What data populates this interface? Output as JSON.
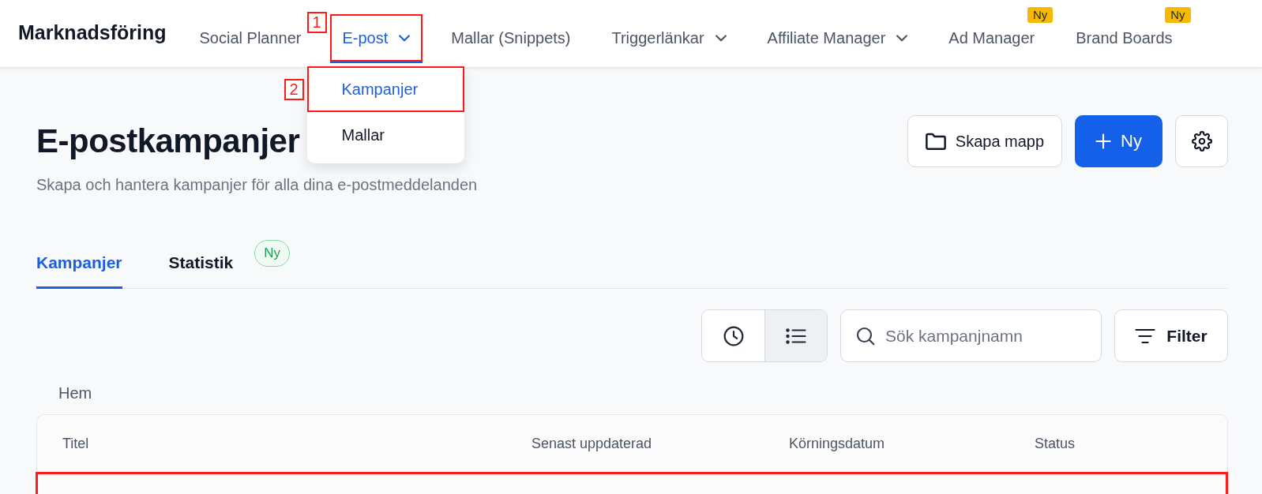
{
  "app": {
    "title": "Marknadsföring"
  },
  "nav": {
    "items": [
      {
        "label": "Social Planner",
        "selected": false,
        "has_menu": false,
        "highlighted": false
      },
      {
        "label": "E-post",
        "selected": true,
        "has_menu": true,
        "highlighted": true,
        "callout": "1",
        "menu": [
          {
            "label": "Kampanjer",
            "selected": true,
            "highlighted": true,
            "callout": "2"
          },
          {
            "label": "Mallar",
            "selected": false,
            "highlighted": false
          }
        ]
      },
      {
        "label": "Mallar (Snippets)",
        "selected": false,
        "has_menu": false,
        "highlighted": false
      },
      {
        "label": "Triggerlänkar",
        "selected": false,
        "has_menu": true,
        "highlighted": false
      },
      {
        "label": "Affiliate Manager",
        "selected": false,
        "has_menu": true,
        "highlighted": false
      },
      {
        "label": "Ad Manager",
        "selected": false,
        "has_menu": false,
        "highlighted": false,
        "badge": "Ny"
      },
      {
        "label": "Brand Boards",
        "selected": false,
        "has_menu": false,
        "highlighted": false,
        "badge": "Ny"
      }
    ]
  },
  "header": {
    "title": "E-postkampanjer",
    "subtitle": "Skapa och hantera kampanjer för alla dina e-postmeddelanden",
    "actions": [
      {
        "kind": "folder",
        "label": "Skapa mapp"
      },
      {
        "kind": "new",
        "label": "Ny"
      },
      {
        "kind": "settings"
      }
    ]
  },
  "tabs": [
    {
      "label": "Kampanjer",
      "selected": true
    },
    {
      "label": "Statistik",
      "selected": false,
      "badge": "Ny"
    }
  ],
  "toolbar": {
    "view_modes": [
      {
        "kind": "clock",
        "selected": false
      },
      {
        "kind": "list",
        "selected": true
      }
    ],
    "search": {
      "placeholder": "Sök kampanjnamn"
    },
    "filter": {
      "label": "Filter"
    }
  },
  "breadcrumb": [
    "Hem"
  ],
  "table": {
    "columns": [
      "Titel",
      "Senast uppdaterad",
      "Körningsdatum",
      "Status"
    ],
    "highlighted_row": true
  }
}
